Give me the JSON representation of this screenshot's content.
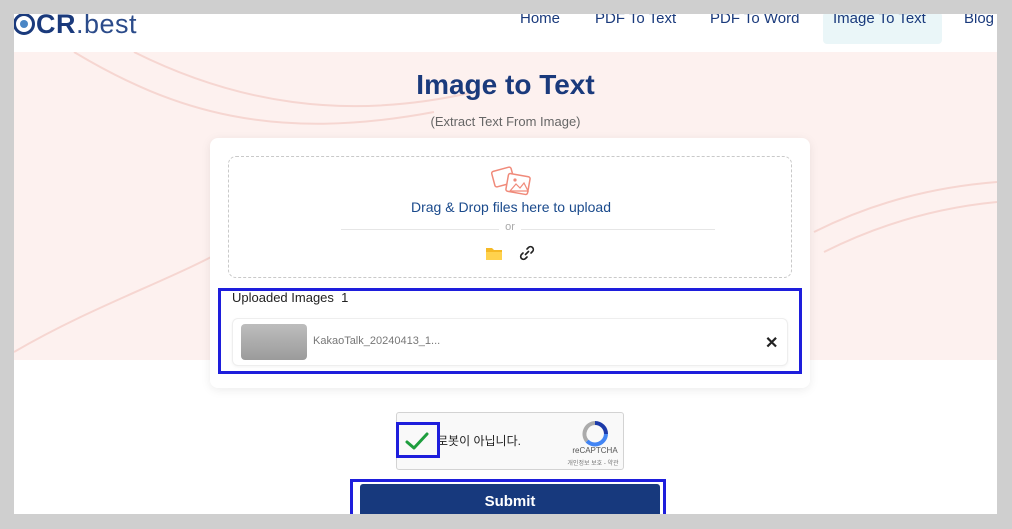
{
  "brand": {
    "logo_bold": "CR",
    "logo_light": ".best"
  },
  "nav": {
    "items": [
      {
        "label": "Home"
      },
      {
        "label": "PDF To Text"
      },
      {
        "label": "PDF To Word"
      },
      {
        "label": "Image To Text",
        "active": true
      },
      {
        "label": "Blog"
      }
    ]
  },
  "hero": {
    "title": "Image to Text",
    "subtitle": "(Extract Text From Image)"
  },
  "upload": {
    "dropzone_text": "Drag & Drop files here to upload",
    "or_text": "or",
    "icons": [
      "images-icon",
      "folder-icon",
      "link-icon"
    ],
    "uploaded_label": "Uploaded Images",
    "uploaded_count": "1",
    "files": [
      {
        "name": "KakaoTalk_20240413_1..."
      }
    ]
  },
  "captcha": {
    "label": "로봇이 아닙니다.",
    "brand": "reCAPTCHA",
    "terms": "개인정보 보호 - 약관",
    "checked": true
  },
  "submit_label": "Submit",
  "colors": {
    "primary": "#17397d",
    "nav_active_bg": "#eaf6f8",
    "hero_bg": "#fdf1ef",
    "highlight": "#1e1edc",
    "check": "#1e9e3e"
  }
}
